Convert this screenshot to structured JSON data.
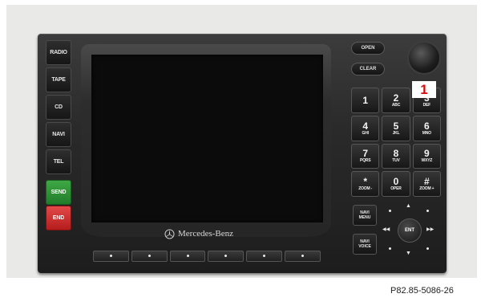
{
  "side_buttons": [
    {
      "label": "RADIO"
    },
    {
      "label": "TAPE"
    },
    {
      "label": "CD"
    },
    {
      "label": "NAVI"
    },
    {
      "label": "TEL"
    },
    {
      "label": "SEND"
    },
    {
      "label": "END"
    }
  ],
  "top_buttons": {
    "open": "OPEN",
    "clear": "CLEAR"
  },
  "callout": "1",
  "keypad": [
    {
      "num": "1",
      "sub": ""
    },
    {
      "num": "2",
      "sub": "ABC"
    },
    {
      "num": "3",
      "sub": "DEF"
    },
    {
      "num": "4",
      "sub": "GHI"
    },
    {
      "num": "5",
      "sub": "JKL"
    },
    {
      "num": "6",
      "sub": "MNO"
    },
    {
      "num": "7",
      "sub": "PQRS"
    },
    {
      "num": "8",
      "sub": "TUV"
    },
    {
      "num": "9",
      "sub": "WXYZ"
    },
    {
      "num": "*",
      "sub": "ZOOM -"
    },
    {
      "num": "0",
      "sub": "OPER"
    },
    {
      "num": "#",
      "sub": "ZOOM +"
    }
  ],
  "navi_menu": {
    "line1": "NAVI",
    "line2": "MENU"
  },
  "navi_voice": {
    "line1": "NAVI",
    "line2": "VOICE"
  },
  "joystick": {
    "center": "ENT",
    "left": "◀◀",
    "right": "▶▶",
    "up": "▲",
    "down": "▼"
  },
  "brand": "Mercedes-Benz",
  "caption": "P82.85-5086-26",
  "colors": {
    "send": "#2f9a3a",
    "end": "#d22a2a",
    "callout": "#d10f0f"
  }
}
